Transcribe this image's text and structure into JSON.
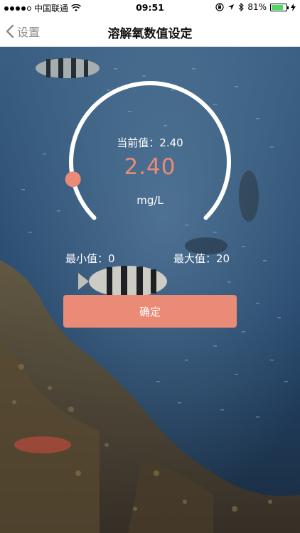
{
  "status_bar": {
    "carrier": "中国联通",
    "time": "09:51",
    "battery_text": "81%",
    "battery_level": 0.81,
    "icons": [
      "signal-dots-icon",
      "wifi-icon",
      "screen-lock-icon",
      "location-icon",
      "bluetooth-icon",
      "battery-icon",
      "charging-icon"
    ]
  },
  "nav": {
    "back_label": "设置",
    "title": "溶解氧数值设定"
  },
  "gauge": {
    "current_label": "当前值：2.40",
    "current_value": "2.40",
    "unit": "mg/L",
    "min_label": "最小值：0",
    "max_label": "最大值：20",
    "min": 0,
    "max": 20,
    "value": 2.4
  },
  "confirm_label": "确定",
  "colors": {
    "accent": "#e98b76",
    "arc": "#ffffff",
    "nav_bg": "#ffffff",
    "text_on_bg": "#ffffff"
  }
}
